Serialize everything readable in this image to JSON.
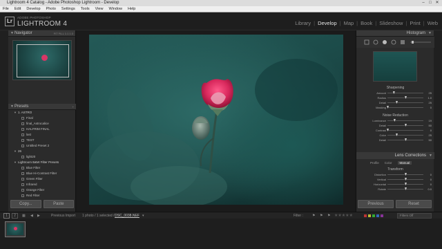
{
  "window": {
    "title": "Lightroom 4 Catalog - Adobe Photoshop Lightroom - Develop",
    "buttons": [
      "–",
      "□",
      "✕"
    ]
  },
  "menu": [
    "File",
    "Edit",
    "Develop",
    "Photo",
    "Settings",
    "Tools",
    "View",
    "Window",
    "Help"
  ],
  "identity": {
    "badge": "Lr",
    "small": "ADOBE PHOTOSHOP",
    "big": "LIGHTROOM 4"
  },
  "modules": [
    "Library",
    "Develop",
    "Map",
    "Book",
    "Slideshow",
    "Print",
    "Web"
  ],
  "navigator": {
    "title": "Navigator",
    "zoom_options": "FIT  FILL  1:1  1:3"
  },
  "presets": {
    "title": "Presets",
    "rows": [
      {
        "type": "folder",
        "label": "1. ASTRO"
      },
      {
        "type": "item",
        "label": "Final"
      },
      {
        "type": "item",
        "label": "final_Astrocalice"
      },
      {
        "type": "item",
        "label": "HALFRIM FINAL"
      },
      {
        "type": "item",
        "label": "last"
      },
      {
        "type": "item",
        "label": "TEST"
      },
      {
        "type": "item",
        "label": "Untitled Preset 2"
      },
      {
        "type": "folder",
        "label": "26"
      },
      {
        "type": "item",
        "label": "light20"
      },
      {
        "type": "folder",
        "label": "Lightroom B&W Filter Presets"
      },
      {
        "type": "item",
        "label": "Blue Filter"
      },
      {
        "type": "item",
        "label": "Blue Hi-Contrast Filter"
      },
      {
        "type": "item",
        "label": "Green Filter"
      },
      {
        "type": "item",
        "label": "Infrared"
      },
      {
        "type": "item",
        "label": "Orange Filter"
      },
      {
        "type": "item",
        "label": "Red Filter"
      }
    ]
  },
  "left_buttons": {
    "copy": "Copy...",
    "paste": "Paste"
  },
  "histogram": {
    "title": "Histogram"
  },
  "sharpening": {
    "title": "Sharpening",
    "sliders": [
      {
        "label": "Amount",
        "value": "25",
        "pos": 0.17
      },
      {
        "label": "Radius",
        "value": "1.0",
        "pos": 0.5
      },
      {
        "label": "Detail",
        "value": "25",
        "pos": 0.25
      },
      {
        "label": "Masking",
        "value": "0",
        "pos": 0.0
      }
    ]
  },
  "noise": {
    "title": "Noise Reduction",
    "sliders": [
      {
        "label": "Luminance",
        "value": "19",
        "pos": 0.19
      },
      {
        "label": "Detail",
        "value": "50",
        "pos": 0.5
      },
      {
        "label": "Contrast",
        "value": "0",
        "pos": 0.0
      },
      {
        "label": "Color",
        "value": "25",
        "pos": 0.25
      },
      {
        "label": "Detail",
        "value": "50",
        "pos": 0.5
      }
    ]
  },
  "lens": {
    "title": "Lens Corrections",
    "tabs": [
      "Profile",
      "Color",
      "Manual"
    ],
    "transform_title": "Transform",
    "sliders": [
      {
        "label": "Distortion",
        "value": "0",
        "pos": 0.5
      },
      {
        "label": "Vertical",
        "value": "0",
        "pos": 0.5
      },
      {
        "label": "Horizontal",
        "value": "0",
        "pos": 0.5
      },
      {
        "label": "Rotate",
        "value": "0.0",
        "pos": 0.5
      }
    ]
  },
  "right_buttons": {
    "previous": "Previous",
    "reset": "Reset"
  },
  "toolbar": {
    "page_nums": [
      "1",
      "2"
    ],
    "previous_import": "Previous Import",
    "selection": "1 photo / 1 selected /",
    "filename": "DSC_0038.NEF",
    "filter_label": "Filter :",
    "filters_off": "Filters Off"
  },
  "colors": {
    "accent": "#d93666",
    "bg": "#1a1a1a",
    "panel": "#2b2b2b"
  }
}
